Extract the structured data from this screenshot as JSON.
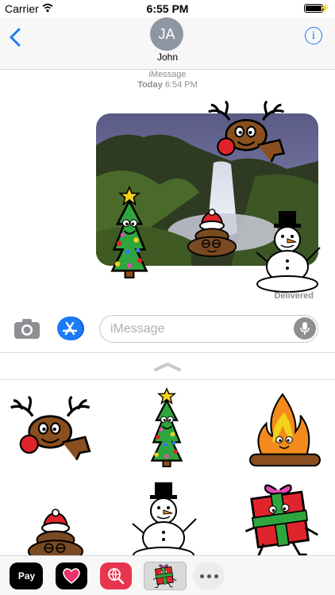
{
  "status_bar": {
    "carrier": "Carrier",
    "time": "6:55 PM",
    "battery_level": 1.0
  },
  "header": {
    "avatar_initials": "JA",
    "contact_name": "John"
  },
  "chat": {
    "service": "iMessage",
    "timestamp_day": "Today",
    "timestamp_time": "6:54 PM",
    "delivery_status": "Delivered"
  },
  "input": {
    "placeholder": "iMessage"
  },
  "app_strip": {
    "apple_pay_label": "Pay"
  },
  "icons": [
    "wifi-icon",
    "battery-icon",
    "back-chevron-icon",
    "info-icon",
    "camera-icon",
    "app-store-icon",
    "microphone-icon",
    "heart-icon",
    "globe-search-icon",
    "more-dots-icon"
  ],
  "colors": {
    "accent": "#1a7cf6",
    "search_app": "#e8344e",
    "tree": "#2fa63d",
    "nose": "#e0242b"
  }
}
